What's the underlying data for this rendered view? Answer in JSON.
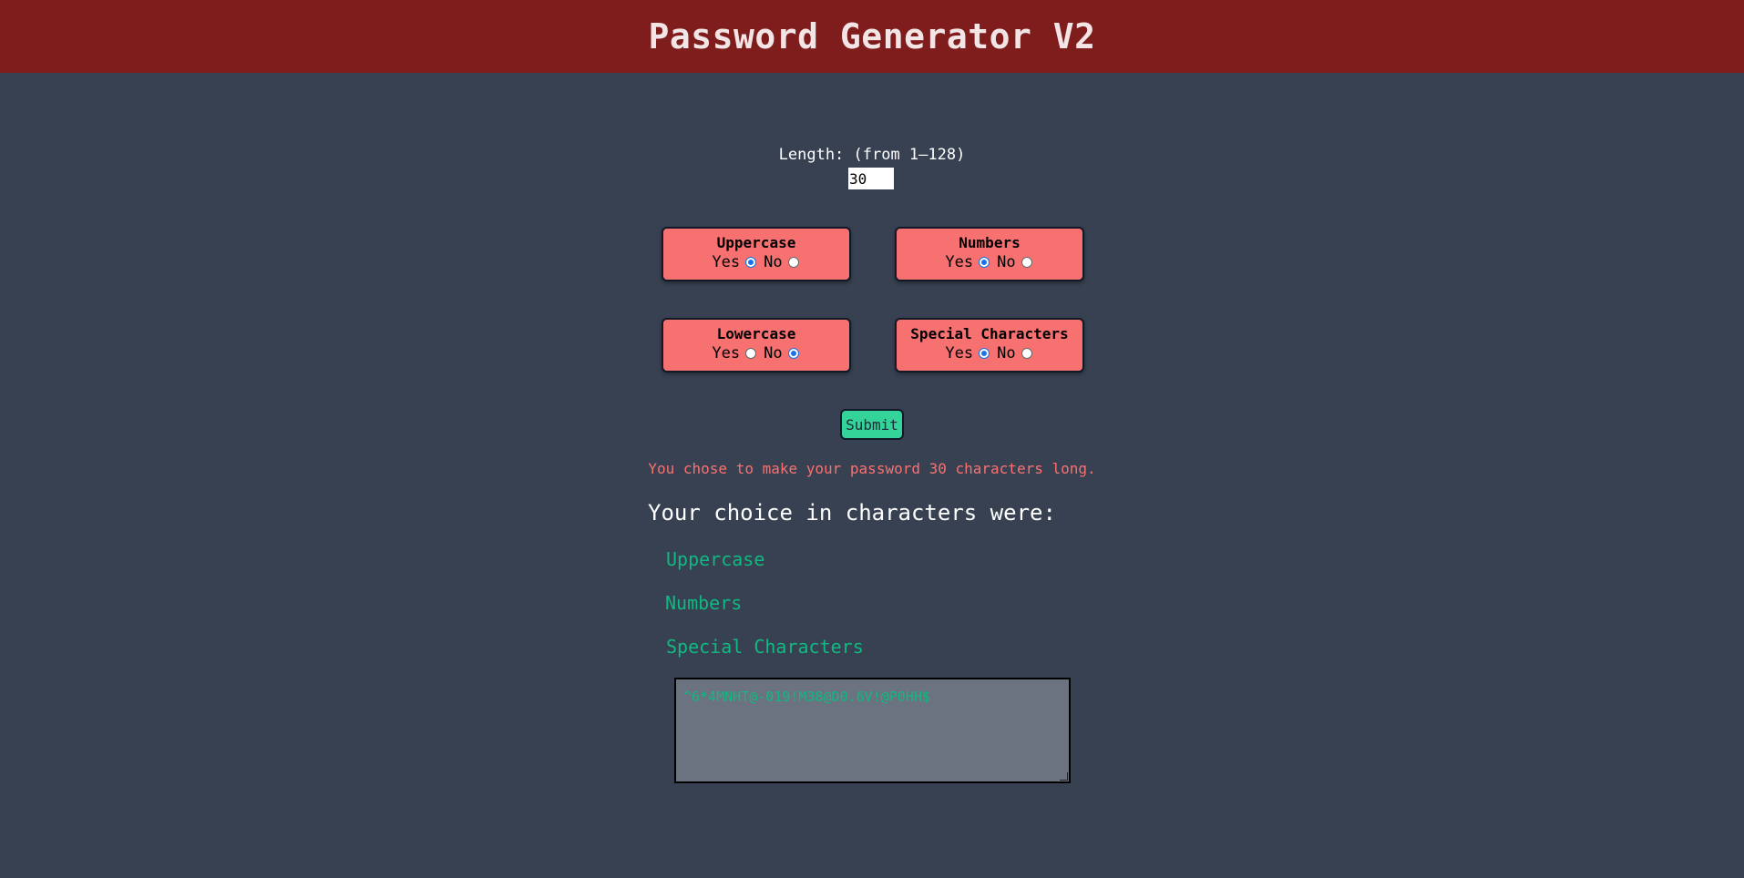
{
  "header": {
    "title": "Password Generator V2"
  },
  "length": {
    "label": "Length: (from 1–128)",
    "value": "30"
  },
  "options": [
    {
      "title": "Uppercase",
      "yes_label": "Yes",
      "no_label": "No",
      "selected": "yes"
    },
    {
      "title": "Numbers",
      "yes_label": "Yes",
      "no_label": "No",
      "selected": "yes"
    },
    {
      "title": "Lowercase",
      "yes_label": "Yes",
      "no_label": "No",
      "selected": "no"
    },
    {
      "title": "Special Characters",
      "yes_label": "Yes",
      "no_label": "No",
      "selected": "yes"
    }
  ],
  "submit": {
    "label": "Submit"
  },
  "result": {
    "length_message": "You chose to make your password 30 characters long.",
    "choice_heading": "Your choice in characters were:",
    "choices": [
      "Uppercase",
      "Numbers",
      "Special Characters"
    ],
    "password": "^6*4MNHT@-019!M38@D0.6V!@P0HH$"
  },
  "colors": {
    "header_bg": "#7f1d1d",
    "page_bg": "#374151",
    "option_bg": "#f87171",
    "submit_bg": "#34d399",
    "accent_green": "#10b981",
    "message_red": "#f87171",
    "output_bg": "#6b7280"
  }
}
